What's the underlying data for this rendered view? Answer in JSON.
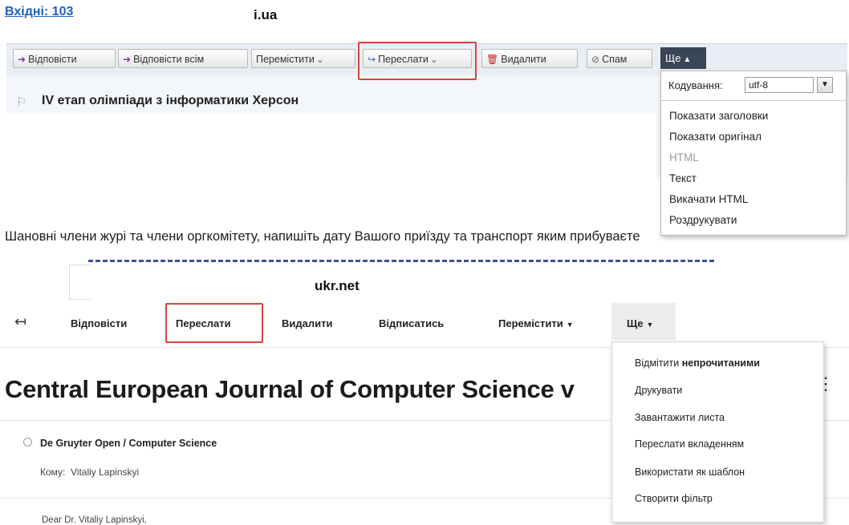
{
  "iua": {
    "caption": "i.ua",
    "inbox_label": "Вхідні:",
    "inbox_count": "103",
    "toolbar": {
      "reply": "Відповісти",
      "reply_all": "Відповісти всім",
      "move": "Перемістити",
      "forward": "Переслати",
      "delete": "Видалити",
      "spam": "Спам",
      "more": "Ще"
    },
    "subject": "IV етап олімпіади з інформатики Херсон",
    "menu": {
      "encoding_label": "Кодування:",
      "encoding_value": "utf-8",
      "items": [
        "Показати заголовки",
        "Показати оригінал",
        "HTML",
        "Текст",
        "Викачати HTML",
        "Роздрукувати"
      ]
    },
    "letter_text": "Шановні члени журі та члени оргкомітету, напишіть дату Вашого приїзду та транспорт яким прибуваєте"
  },
  "ukr": {
    "caption": "ukr.net",
    "toolbar": {
      "reply": "Відповісти",
      "forward": "Переслати",
      "delete": "Видалити",
      "unsubscribe": "Відписатись",
      "move": "Перемістити",
      "more": "Ще"
    },
    "headline": "Central European Journal of Computer Science v",
    "sender": "De Gruyter Open / Computer Science",
    "to_label": "Кому:",
    "to_value": "Vitaliy Lapinskyi",
    "greeting": "Dear Dr. Vitaliy Lapinskyi,",
    "menu": {
      "mark_prefix": "Відмітити",
      "mark_bold": "непрочитаними",
      "items": [
        "Друкувати",
        "Завантажити листа",
        "Переслати вкладенням",
        "Використати як шаблон",
        "Створити фільтр"
      ]
    }
  },
  "colors": {
    "highlight": "#d9463b",
    "link": "#1d63b8",
    "more_button_bg": "#3a4656"
  }
}
